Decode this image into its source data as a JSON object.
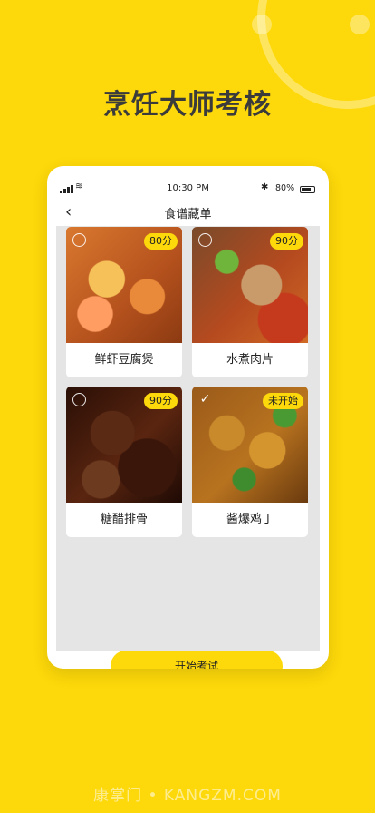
{
  "headline": "烹饪大师考核",
  "statusbar": {
    "time": "10:30 PM",
    "battery": "80%"
  },
  "navbar": {
    "title": "食谱藏单"
  },
  "recipes": [
    {
      "name": "鲜虾豆腐煲",
      "badge": "80分",
      "done": false
    },
    {
      "name": "水煮肉片",
      "badge": "90分",
      "done": false
    },
    {
      "name": "糖醋排骨",
      "badge": "90分",
      "done": false
    },
    {
      "name": "酱爆鸡丁",
      "badge": "未开始",
      "done": true
    }
  ],
  "start_button": "开始考试",
  "watermark": "康掌门 • KANGZM.COM",
  "colors": {
    "brand_yellow": "#FDD80A",
    "content_bg": "#E5E5E5"
  },
  "icons": {
    "back": "chevron-left-icon",
    "check": "check-icon"
  }
}
